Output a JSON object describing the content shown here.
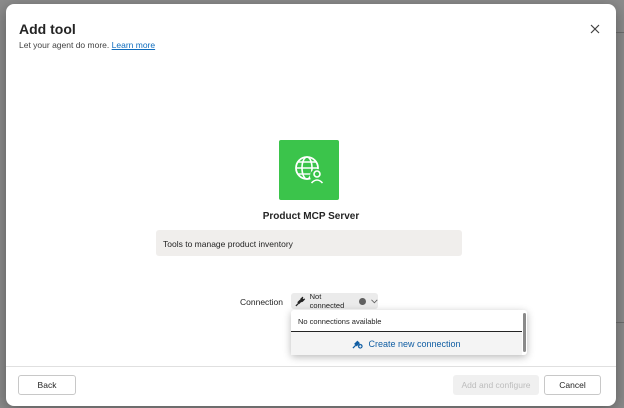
{
  "dialog": {
    "title": "Add tool",
    "subtitle": "Let your agent do more.",
    "learn_more": "Learn more"
  },
  "tool": {
    "icon": "globe-person-icon",
    "icon_bg_color": "#3bc44b",
    "name": "Product MCP Server",
    "description": "Tools to manage product inventory"
  },
  "connection": {
    "label": "Connection",
    "status": "Not connected",
    "menu": {
      "empty_text": "No connections available",
      "create_label": "Create new connection"
    }
  },
  "footer": {
    "back_label": "Back",
    "add_label": "Add and configure",
    "cancel_label": "Cancel"
  },
  "colors": {
    "link": "#0f6cbd",
    "accent_text": "#115ea3"
  }
}
